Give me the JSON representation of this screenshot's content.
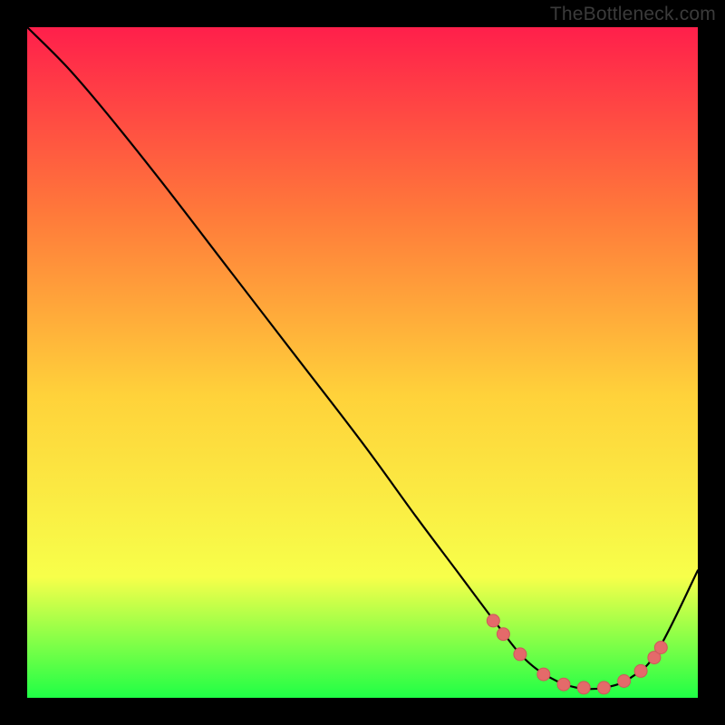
{
  "watermark": "TheBottleneck.com",
  "colors": {
    "page_bg": "#000000",
    "gradient_top": "#ff1f4b",
    "gradient_mid_upper": "#ff7a3a",
    "gradient_mid": "#ffd23a",
    "gradient_lower": "#f7ff4a",
    "gradient_bottom": "#1fff46",
    "curve": "#000000",
    "marker_fill": "#e46a6a",
    "marker_stroke": "#cc5a5a"
  },
  "chart_data": {
    "type": "line",
    "title": "",
    "xlabel": "",
    "ylabel": "",
    "xlim": [
      0,
      100
    ],
    "ylim": [
      0,
      100
    ],
    "series": [
      {
        "name": "bottleneck-curve",
        "x": [
          0,
          6,
          12,
          20,
          30,
          40,
          50,
          58,
          64,
          70,
          74,
          78,
          82,
          86,
          90,
          94,
          100
        ],
        "y": [
          100,
          94,
          87,
          77,
          64,
          51,
          38,
          27,
          19,
          11,
          6,
          3,
          1.5,
          1.5,
          3,
          7,
          19
        ]
      }
    ],
    "markers": {
      "name": "highlight-dots",
      "x": [
        69.5,
        71,
        73.5,
        77,
        80,
        83,
        86,
        89,
        91.5,
        93.5,
        94.5
      ],
      "y": [
        11.5,
        9.5,
        6.5,
        3.5,
        2,
        1.5,
        1.5,
        2.5,
        4,
        6,
        7.5
      ]
    }
  }
}
